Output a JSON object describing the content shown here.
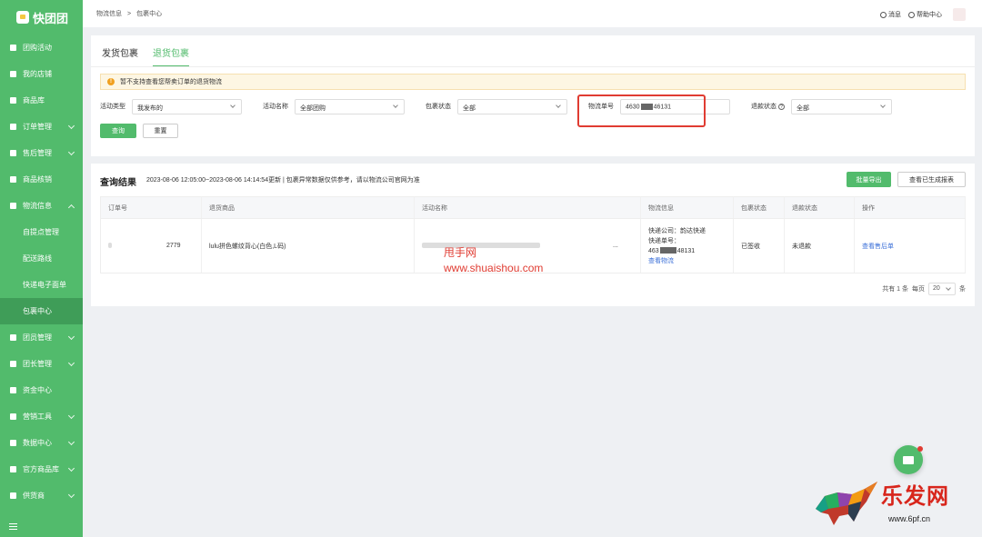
{
  "app": {
    "name": "快团团"
  },
  "sidebar": {
    "items": [
      {
        "label": "团购活动",
        "icon": "book-icon",
        "expand": ""
      },
      {
        "label": "我的店铺",
        "icon": "store-icon",
        "expand": ""
      },
      {
        "label": "商品库",
        "icon": "box-icon",
        "expand": ""
      },
      {
        "label": "订单管理",
        "icon": "order-icon",
        "expand": "down"
      },
      {
        "label": "售后管理",
        "icon": "aftersale-icon",
        "expand": "down"
      },
      {
        "label": "商品核销",
        "icon": "verify-icon",
        "expand": ""
      },
      {
        "label": "物流信息",
        "icon": "truck-icon",
        "expand": "up"
      }
    ],
    "sub_items": [
      {
        "label": "自提点管理"
      },
      {
        "label": "配送路线"
      },
      {
        "label": "快递电子面单"
      },
      {
        "label": "包裹中心",
        "active": true
      }
    ],
    "items2": [
      {
        "label": "团员管理",
        "icon": "user-icon"
      },
      {
        "label": "团长管理",
        "icon": "leader-icon"
      },
      {
        "label": "资金中心",
        "icon": "money-icon"
      },
      {
        "label": "营销工具",
        "icon": "tag-icon"
      },
      {
        "label": "数据中心",
        "icon": "chart-icon"
      },
      {
        "label": "官方商品库",
        "icon": "heart-icon"
      },
      {
        "label": "供货商",
        "icon": "supplier-icon"
      }
    ]
  },
  "header": {
    "breadcrumb": [
      "物流信息",
      "包裹中心"
    ],
    "separator": ">",
    "messages": "消息",
    "help": "帮助中心"
  },
  "tabs": [
    {
      "label": "发货包裹",
      "active": false
    },
    {
      "label": "退货包裹",
      "active": true
    }
  ],
  "notice": {
    "icon": "!",
    "text": "暂不支持查看您帮卖订单的退货物流"
  },
  "filters": {
    "activity_type": {
      "label": "活动类型",
      "value": "我发布的"
    },
    "activity_name": {
      "label": "活动名称",
      "value": "全部团购"
    },
    "package_status": {
      "label": "包裹状态",
      "value": "全部"
    },
    "tracking_no": {
      "label": "物流单号",
      "value_prefix": "4630",
      "value_suffix": "46131"
    },
    "refund_status": {
      "label": "退款状态",
      "help": "?",
      "value": "全部"
    },
    "query_button": "查询",
    "reset_button": "重置"
  },
  "results": {
    "title": "查询结果",
    "info": "2023-08-06 12:05:00~2023-08-06 14:14:54更新 | 包裹异常数据仅供参考，请以物流公司官网为准",
    "export_button": "批量导出",
    "reports_button": "查看已生成报表",
    "columns": [
      "订单号",
      "退货商品",
      "活动名称",
      "物流信息",
      "包裹状态",
      "退款状态",
      "操作"
    ],
    "rows": [
      {
        "order_no": "2779",
        "product": "lulu拼色螺纹背心(白色,L码)",
        "activity_suffix": "...",
        "courier": "快递公司：韵达快递",
        "tracking_label": "快递单号：",
        "tracking_prefix": "463",
        "tracking_suffix": "48131",
        "view_logistics": "查看物流",
        "package_status": "已签收",
        "refund_status": "未退款",
        "action": "查看售后单"
      }
    ],
    "pager": {
      "total": "共有 1 条",
      "per_page_label": "每页",
      "page_size": "20",
      "unit": "条"
    }
  },
  "watermarks": {
    "site1_name": "甩手网",
    "site1_url": "www.shuaishou.com",
    "site2_name": "乐发网",
    "site2_url": "www.6pf.cn"
  },
  "colors": {
    "brand": "#52bb6c",
    "highlight": "#e03c32",
    "link": "#3a6fd8"
  }
}
